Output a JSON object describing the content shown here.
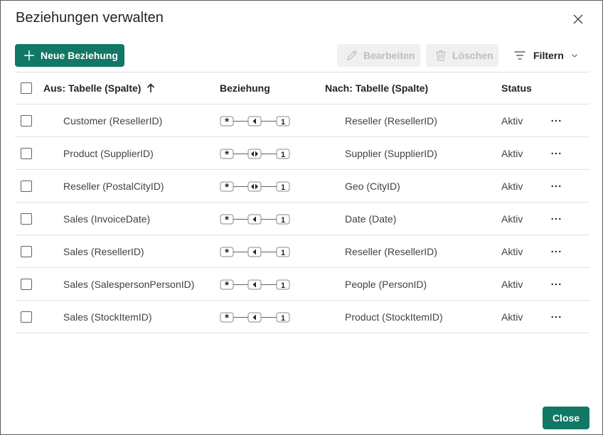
{
  "dialog": {
    "title": "Beziehungen verwalten",
    "close_icon": "close-icon"
  },
  "toolbar": {
    "new_label": "Neue Beziehung",
    "edit_label": "Bearbeiten",
    "delete_label": "Löschen",
    "filter_label": "Filtern"
  },
  "table": {
    "headers": {
      "from": "Aus: Tabelle (Spalte)",
      "relationship": "Beziehung",
      "to": "Nach: Tabelle (Spalte)",
      "status": "Status"
    },
    "sort_icon": "arrow-up-icon",
    "rows": [
      {
        "from": "Customer (ResellerID)",
        "from_card": "*",
        "direction": "single",
        "to_card": "1",
        "to": "Reseller (ResellerID)",
        "status": "Aktiv"
      },
      {
        "from": "Product (SupplierID)",
        "from_card": "*",
        "direction": "both",
        "to_card": "1",
        "to": "Supplier (SupplierID)",
        "status": "Aktiv"
      },
      {
        "from": "Reseller (PostalCityID)",
        "from_card": "*",
        "direction": "both",
        "to_card": "1",
        "to": "Geo (CityID)",
        "status": "Aktiv"
      },
      {
        "from": "Sales (InvoiceDate)",
        "from_card": "*",
        "direction": "single",
        "to_card": "1",
        "to": "Date (Date)",
        "status": "Aktiv"
      },
      {
        "from": "Sales (ResellerID)",
        "from_card": "*",
        "direction": "single",
        "to_card": "1",
        "to": "Reseller (ResellerID)",
        "status": "Aktiv"
      },
      {
        "from": "Sales (SalespersonPersonID)",
        "from_card": "*",
        "direction": "single",
        "to_card": "1",
        "to": "People (PersonID)",
        "status": "Aktiv"
      },
      {
        "from": "Sales (StockItemID)",
        "from_card": "*",
        "direction": "single",
        "to_card": "1",
        "to": "Product (StockItemID)",
        "status": "Aktiv"
      }
    ]
  },
  "footer": {
    "close_label": "Close"
  },
  "colors": {
    "accent": "#117865",
    "disabled_bg": "#f0f0f0",
    "disabled_text": "#bdbdbd",
    "divider": "#e0e0e0"
  }
}
